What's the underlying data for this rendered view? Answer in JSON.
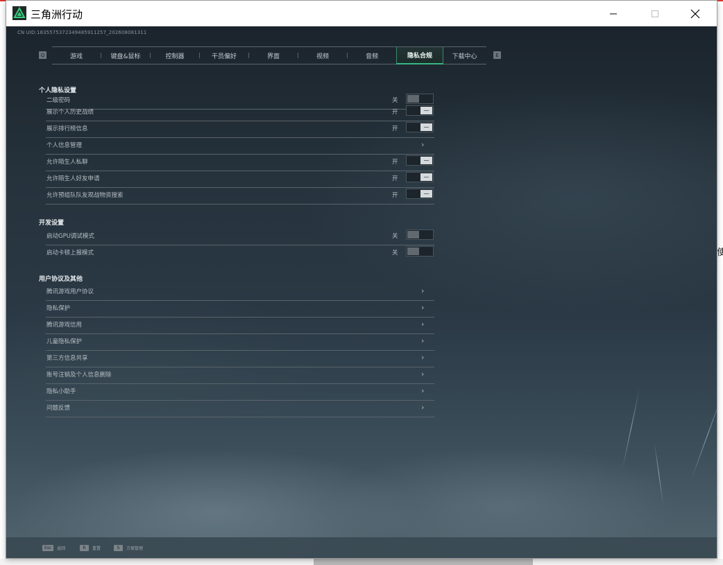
{
  "window": {
    "title": "三角洲行动"
  },
  "window_controls": {
    "minimize": "—",
    "maximize": "☐",
    "close": "✕"
  },
  "game_id": "CN UID:1835575372349485911257_202608081311",
  "tab_nav": {
    "prev_key": "Q",
    "next_key": "E"
  },
  "tabs": [
    {
      "label": "游戏"
    },
    {
      "label": "键盘&鼠标"
    },
    {
      "label": "控制器"
    },
    {
      "label": "干员偏好"
    },
    {
      "label": "界面"
    },
    {
      "label": "视频"
    },
    {
      "label": "音频"
    },
    {
      "label": "隐私合规",
      "active": true
    },
    {
      "label": "下载中心"
    }
  ],
  "sections": {
    "privacy": {
      "title": "个人隐私设置",
      "rows": [
        {
          "label": "二级密码",
          "state": "关",
          "control": "toggle-off"
        },
        {
          "label": "展示个人历史战绩",
          "state": "开",
          "control": "toggle-on"
        },
        {
          "label": "展示排行榜信息",
          "state": "开",
          "control": "toggle-on"
        },
        {
          "label": "个人信息管理",
          "state": "",
          "control": "chevron"
        },
        {
          "label": "允许陌生人私聊",
          "state": "开",
          "control": "toggle-on"
        },
        {
          "label": "允许陌生人好友申请",
          "state": "开",
          "control": "toggle-on"
        },
        {
          "label": "允许预组队队友观战物资搜索",
          "state": "开",
          "control": "toggle-on"
        }
      ]
    },
    "dev": {
      "title": "开发设置",
      "rows": [
        {
          "label": "启动GPU调试模式",
          "state": "关",
          "control": "toggle-off"
        },
        {
          "label": "启动卡顿上报模式",
          "state": "关",
          "control": "toggle-off"
        }
      ]
    },
    "agreements": {
      "title": "用户协议及其他",
      "rows": [
        {
          "label": "腾讯游戏用户协议",
          "control": "chevron"
        },
        {
          "label": "隐私保护",
          "control": "chevron"
        },
        {
          "label": "腾讯游戏信用",
          "control": "chevron"
        },
        {
          "label": "儿童隐私保护",
          "control": "chevron"
        },
        {
          "label": "第三方信息共享",
          "control": "chevron"
        },
        {
          "label": "账号注销及个人信息删除",
          "control": "chevron"
        },
        {
          "label": "隐私小助手",
          "control": "chevron"
        },
        {
          "label": "问题反馈",
          "control": "chevron"
        }
      ]
    }
  },
  "chevron_glyph": "›",
  "bottom_hints": [
    {
      "key": "Esc",
      "label": "返回"
    },
    {
      "key": "R",
      "label": "重置"
    },
    {
      "key": "S",
      "label": "方案管理"
    }
  ],
  "background_right_text": "使",
  "colors": {
    "accent": "#37b885",
    "active_tab_border": "#3c8a6a"
  }
}
